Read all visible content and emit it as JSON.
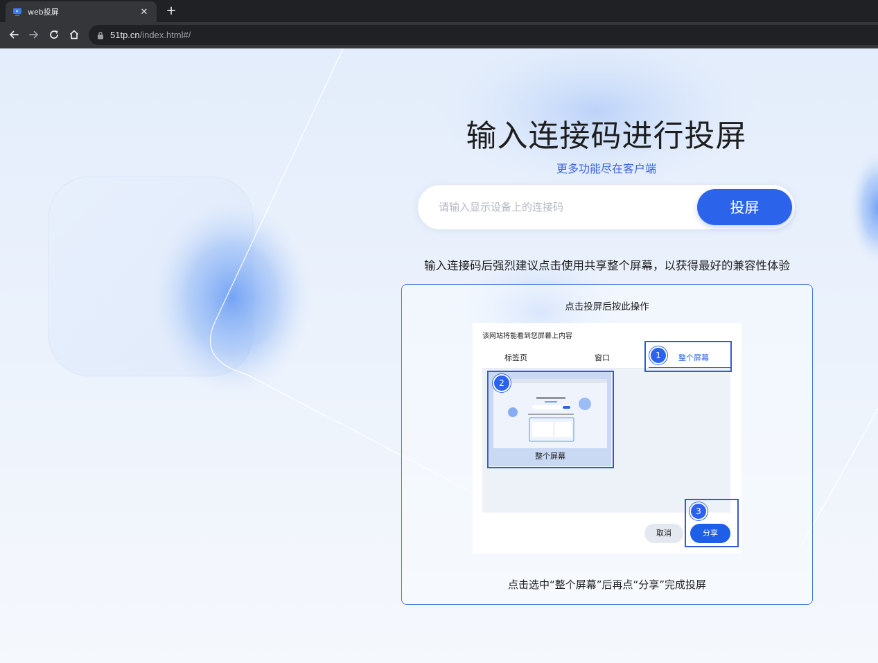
{
  "browser": {
    "tab_title": "web投屏",
    "url_host": "51tp.cn",
    "url_path": "/index.html#/"
  },
  "hero": {
    "title": "输入连接码进行投屏",
    "subtitle": "更多功能尽在客户端",
    "input_placeholder": "请输入显示设备上的连接码",
    "cast_button": "投屏",
    "tip": "输入连接码后强烈建议点击使用共享整个屏幕，以获得最好的兼容性体验"
  },
  "guide": {
    "title": "点击投屏后按此操作",
    "footer": "点击选中“整个屏幕”后再点“分享”完成投屏",
    "dialog": {
      "title": "该网站将能看到您屏幕上内容",
      "tabs": [
        "标签页",
        "窗口",
        "整个屏幕"
      ],
      "thumbnail_label": "整个屏幕",
      "cancel": "取消",
      "share": "分享"
    },
    "steps": [
      "1",
      "2",
      "3"
    ]
  },
  "colors": {
    "accent": "#2b63ea",
    "highlight_border": "#2f5bd6",
    "card_border": "#4a7ae3"
  }
}
